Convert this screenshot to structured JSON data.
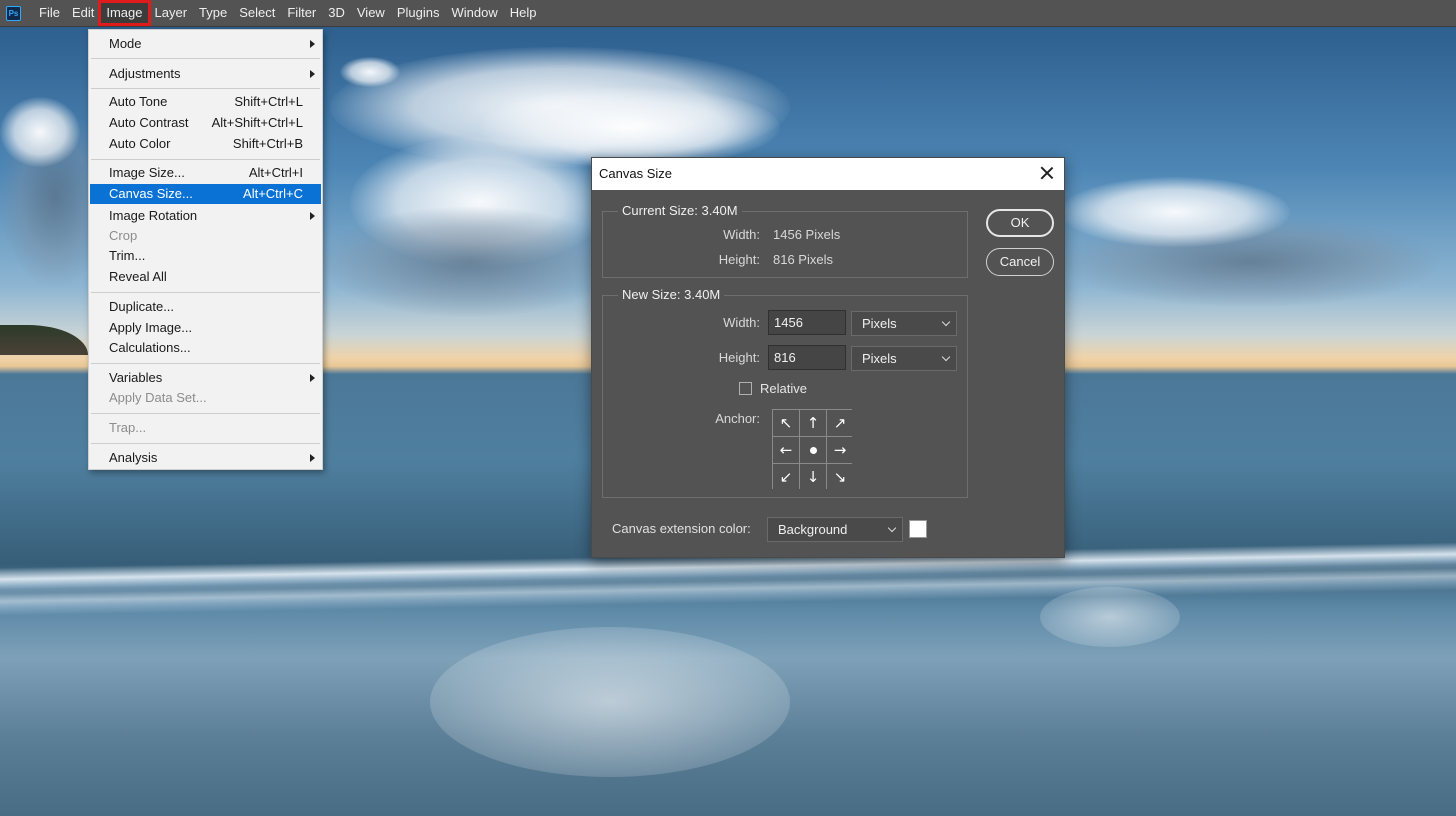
{
  "app": {
    "logo_text": "Ps"
  },
  "menubar": {
    "items": [
      "File",
      "Edit",
      "Image",
      "Layer",
      "Type",
      "Select",
      "Filter",
      "3D",
      "View",
      "Plugins",
      "Window",
      "Help"
    ],
    "active": "Image"
  },
  "image_menu": {
    "mode": "Mode",
    "adjustments": "Adjustments",
    "auto_tone": {
      "label": "Auto Tone",
      "shortcut": "Shift+Ctrl+L"
    },
    "auto_contrast": {
      "label": "Auto Contrast",
      "shortcut": "Alt+Shift+Ctrl+L"
    },
    "auto_color": {
      "label": "Auto Color",
      "shortcut": "Shift+Ctrl+B"
    },
    "image_size": {
      "label": "Image Size...",
      "shortcut": "Alt+Ctrl+I"
    },
    "canvas_size": {
      "label": "Canvas Size...",
      "shortcut": "Alt+Ctrl+C"
    },
    "image_rotation": "Image Rotation",
    "crop": "Crop",
    "trim": "Trim...",
    "reveal_all": "Reveal All",
    "duplicate": "Duplicate...",
    "apply_image": "Apply Image...",
    "calculations": "Calculations...",
    "variables": "Variables",
    "apply_data_set": "Apply Data Set...",
    "trap": "Trap...",
    "analysis": "Analysis"
  },
  "dialog": {
    "title": "Canvas Size",
    "current_size": {
      "legend": "Current Size: 3.40M",
      "width_label": "Width:",
      "width_value": "1456 Pixels",
      "height_label": "Height:",
      "height_value": "816 Pixels"
    },
    "new_size": {
      "legend": "New Size: 3.40M",
      "width_label": "Width:",
      "width_value": "1456",
      "width_unit": "Pixels",
      "height_label": "Height:",
      "height_value": "816",
      "height_unit": "Pixels",
      "relative_label": "Relative",
      "relative_checked": false,
      "anchor_label": "Anchor:"
    },
    "extension_color_label": "Canvas extension color:",
    "extension_color_value": "Background",
    "extension_swatch_color": "#ffffff",
    "ok_label": "OK",
    "cancel_label": "Cancel"
  },
  "colors": {
    "menu_highlight": "#0a72d4",
    "active_outline": "#e01b1b",
    "dialog_bg": "#535353",
    "menubar_bg": "#535353"
  }
}
